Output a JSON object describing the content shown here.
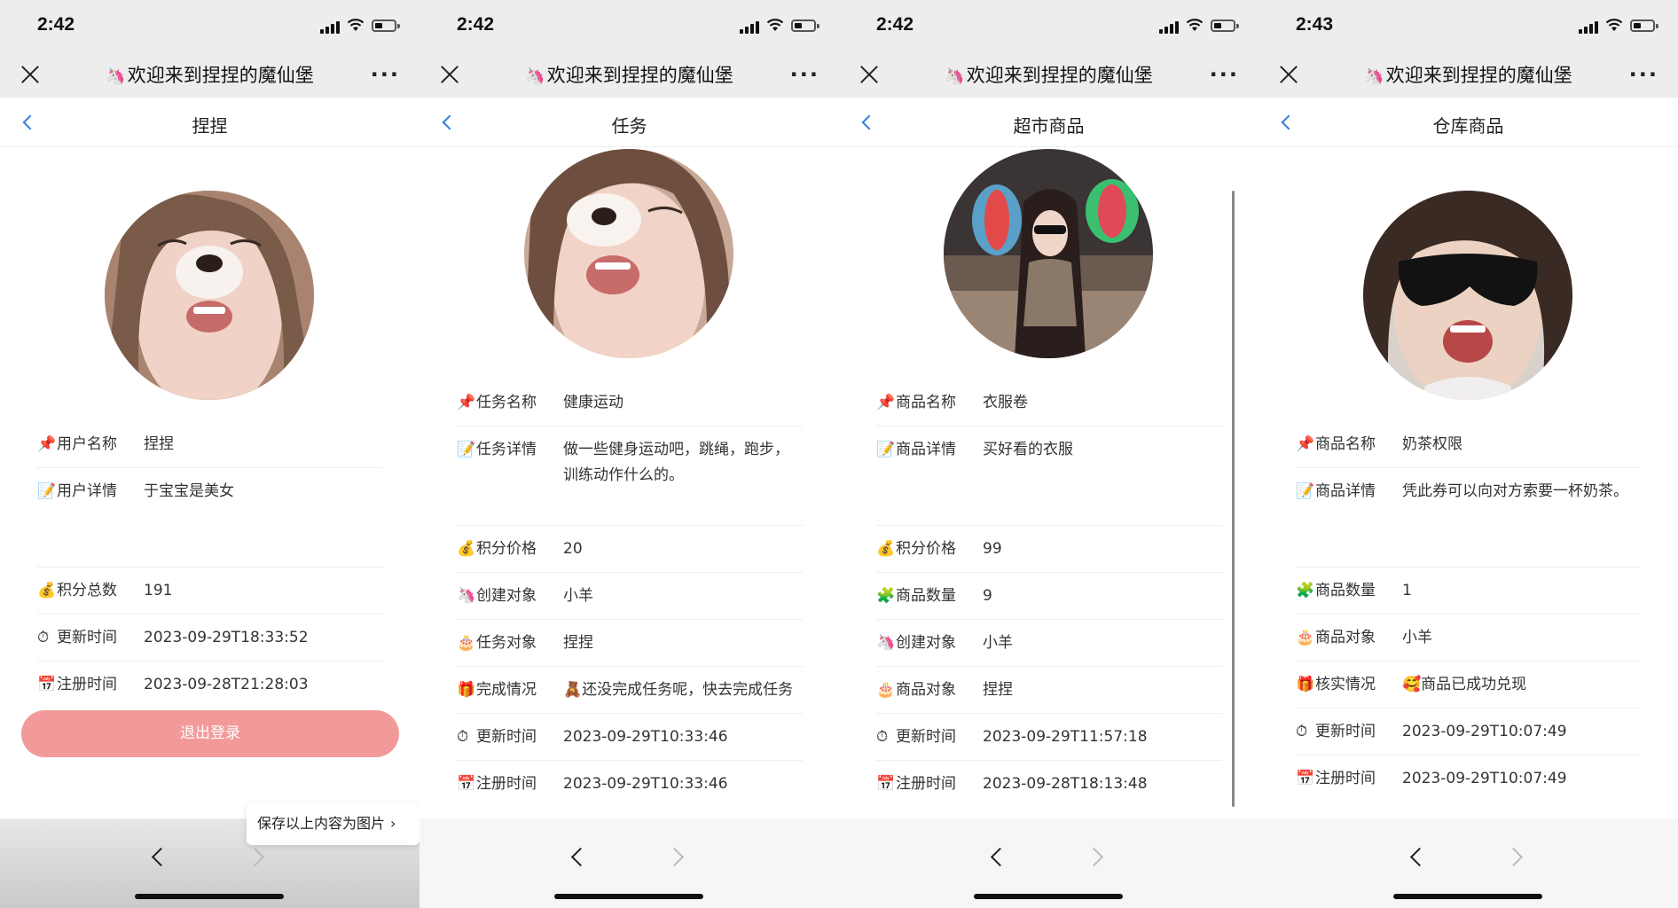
{
  "app": {
    "title": "欢迎来到捏捏的魔仙堡",
    "more": "···"
  },
  "screens": [
    {
      "time": "2:42",
      "page_title": "捏捏",
      "rows": [
        {
          "icon": "📌",
          "label": "用户名称",
          "value": "捏捏"
        },
        {
          "icon": "📝",
          "label": "用户详情",
          "value": "于宝宝是美女"
        },
        {
          "icon": "💰",
          "label": "积分总数",
          "value": "191"
        },
        {
          "icon": "⏱",
          "label": "更新时间",
          "value": "2023-09-29T18:33:52"
        },
        {
          "icon": "📅",
          "label": "注册时间",
          "value": "2023-09-28T21:28:03"
        }
      ],
      "logout_label": "退出登录",
      "save_tip": "保存以上内容为图片",
      "save_tip_chevron": "›"
    },
    {
      "time": "2:42",
      "page_title": "任务",
      "rows": [
        {
          "icon": "📌",
          "label": "任务名称",
          "value": "健康运动"
        },
        {
          "icon": "📝",
          "label": "任务详情",
          "value": "做一些健身运动吧，跳绳，跑步，训练动作什么的。"
        },
        {
          "icon": "💰",
          "label": "积分价格",
          "value": "20"
        },
        {
          "icon": "🦄",
          "label": "创建对象",
          "value": "小羊"
        },
        {
          "icon": "🎂",
          "label": "任务对象",
          "value": "捏捏"
        },
        {
          "icon": "🎁",
          "label": "完成情况",
          "value": "🧸还没完成任务呢，快去完成任务"
        },
        {
          "icon": "⏱",
          "label": "更新时间",
          "value": "2023-09-29T10:33:46"
        },
        {
          "icon": "📅",
          "label": "注册时间",
          "value": "2023-09-29T10:33:46"
        }
      ]
    },
    {
      "time": "2:42",
      "page_title": "超市商品",
      "rows": [
        {
          "icon": "📌",
          "label": "商品名称",
          "value": "衣服卷"
        },
        {
          "icon": "📝",
          "label": "商品详情",
          "value": "买好看的衣服"
        },
        {
          "icon": "💰",
          "label": "积分价格",
          "value": "99"
        },
        {
          "icon": "🧩",
          "label": "商品数量",
          "value": "9"
        },
        {
          "icon": "🦄",
          "label": "创建对象",
          "value": "小羊"
        },
        {
          "icon": "🎂",
          "label": "商品对象",
          "value": "捏捏"
        },
        {
          "icon": "⏱",
          "label": "更新时间",
          "value": "2023-09-29T11:57:18"
        },
        {
          "icon": "📅",
          "label": "注册时间",
          "value": "2023-09-28T18:13:48"
        }
      ]
    },
    {
      "time": "2:43",
      "page_title": "仓库商品",
      "rows": [
        {
          "icon": "📌",
          "label": "商品名称",
          "value": "奶茶权限"
        },
        {
          "icon": "📝",
          "label": "商品详情",
          "value": "凭此券可以向对方索要一杯奶茶。"
        },
        {
          "icon": "🧩",
          "label": "商品数量",
          "value": "1"
        },
        {
          "icon": "🎂",
          "label": "商品对象",
          "value": "小羊"
        },
        {
          "icon": "🎁",
          "label": "核实情况",
          "value": "🥰商品已成功兑现"
        },
        {
          "icon": "⏱",
          "label": "更新时间",
          "value": "2023-09-29T10:07:49"
        },
        {
          "icon": "📅",
          "label": "注册时间",
          "value": "2023-09-29T10:07:49"
        }
      ]
    }
  ],
  "colors": {
    "accent_blue": "#2f7de1",
    "logout_pink": "#f29a9a",
    "topbar_gray": "#ededed"
  }
}
